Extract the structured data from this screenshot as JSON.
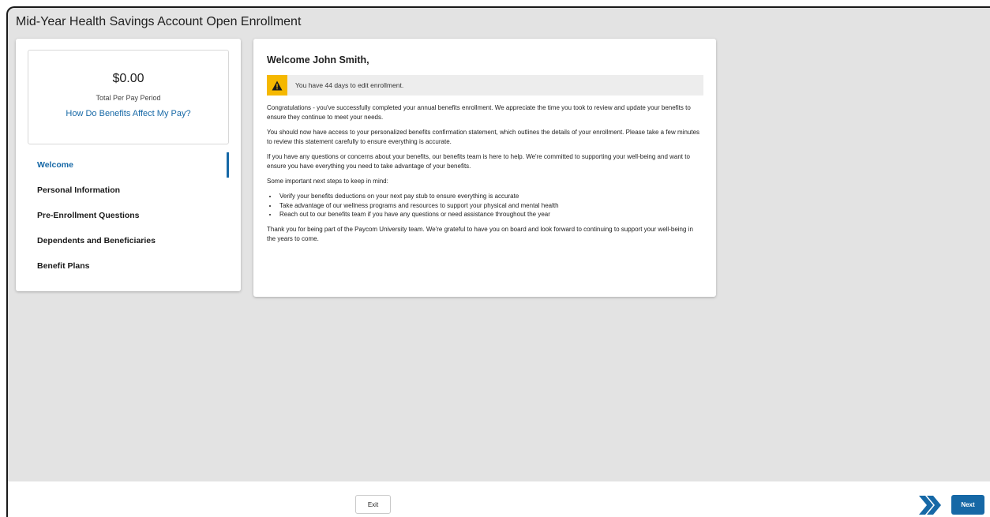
{
  "page": {
    "title": "Mid-Year Health Savings Account Open Enrollment"
  },
  "summary": {
    "amount": "$0.00",
    "amount_label": "Total Per Pay Period",
    "link": "How Do Benefits Affect My Pay?"
  },
  "nav": {
    "items": [
      {
        "label": "Welcome",
        "active": true
      },
      {
        "label": "Personal Information",
        "active": false
      },
      {
        "label": "Pre-Enrollment Questions",
        "active": false
      },
      {
        "label": "Dependents and Beneficiaries",
        "active": false
      },
      {
        "label": "Benefit Plans",
        "active": false
      }
    ]
  },
  "main": {
    "title": "Welcome John Smith,",
    "alert": "You have 44 days to edit enrollment.",
    "paragraphs": [
      "Congratulations - you've successfully completed your annual benefits enrollment. We appreciate the time you took to review and update your benefits to ensure they continue to meet your needs.",
      "You should now have access to your personalized benefits confirmation statement, which outlines the details of your enrollment. Please take a few minutes to review this statement carefully to ensure everything is accurate.",
      "If you have any questions or concerns about your benefits, our benefits team is here to help. We're committed to supporting your well-being and want to ensure you have everything you need to take advantage of your benefits.",
      "Some important next steps to keep in mind:"
    ],
    "steps": [
      "Verify your benefits deductions on your next pay stub to ensure everything is accurate",
      "Take advantage of our wellness programs and resources to support your physical and mental health",
      "Reach out to our benefits team if you have any questions or need assistance throughout the year"
    ],
    "closing": "Thank you for being part of the Paycom University team. We're grateful to have you on board and look forward to continuing to support your well-being in the years to come."
  },
  "footer": {
    "exit_label": "Exit",
    "next_label": "Next",
    "chevron_icon": "double-chevron-right-icon"
  },
  "colors": {
    "accent": "#1668a6",
    "warning": "#f5b800",
    "background": "#e3e3e3"
  }
}
